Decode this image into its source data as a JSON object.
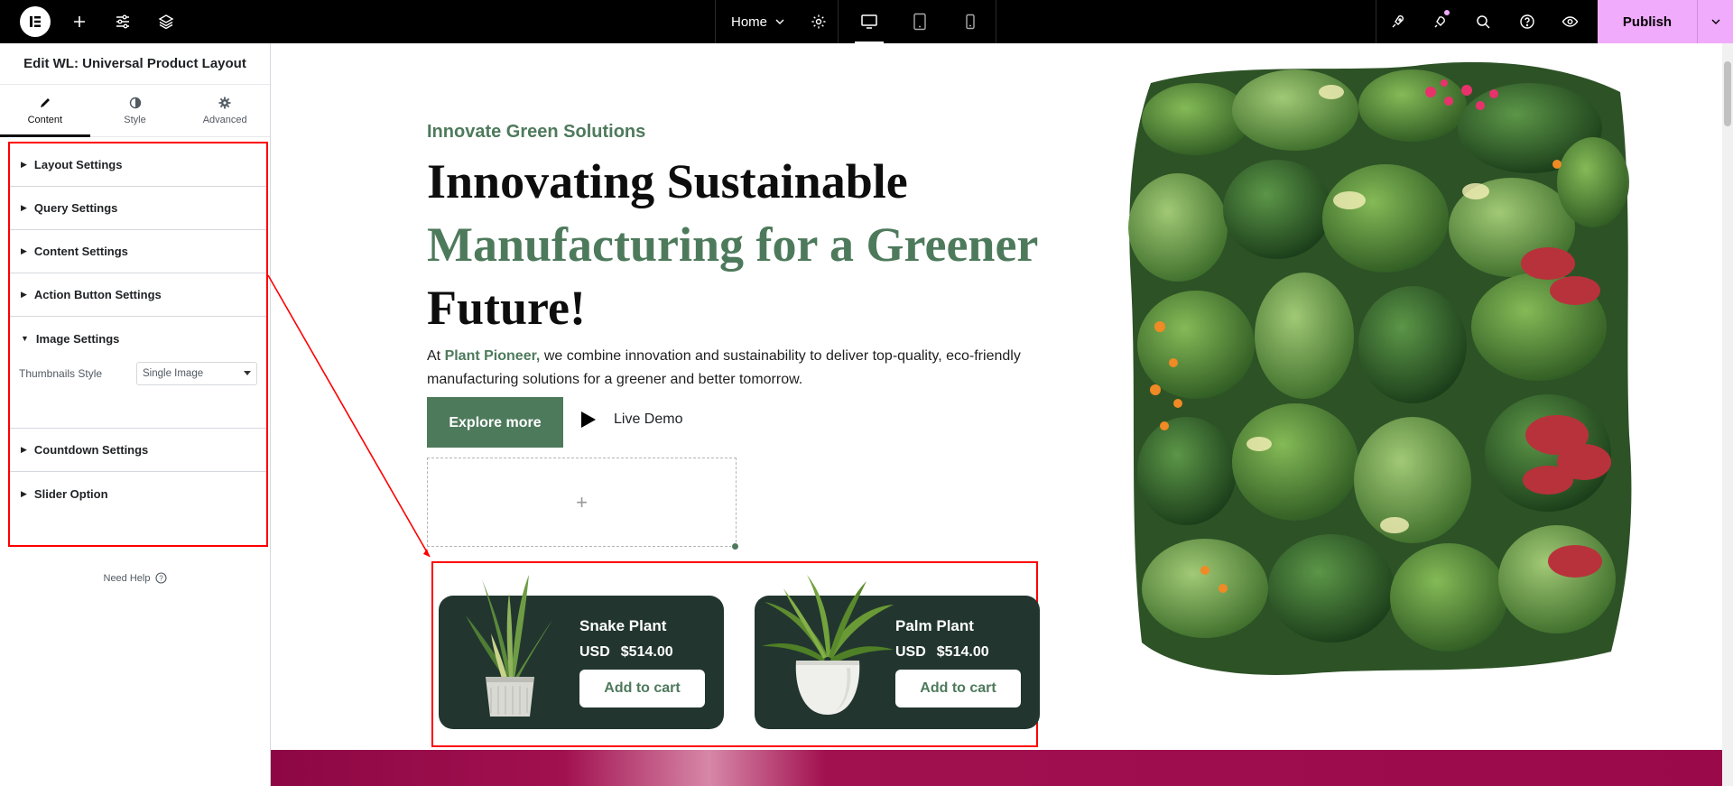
{
  "topbar": {
    "page_name": "Home",
    "publish_label": "Publish",
    "icons": [
      "elementor-logo-icon",
      "add-icon",
      "settings-sliders-icon",
      "layers-icon",
      "page-settings-icon",
      "desktop-icon",
      "tablet-icon",
      "mobile-icon",
      "launch-icon",
      "notifications-icon",
      "search-icon",
      "help-icon",
      "preview-icon"
    ]
  },
  "panel": {
    "title": "Edit WL: Universal Product Layout",
    "tabs": [
      {
        "label": "Content",
        "active": true
      },
      {
        "label": "Style",
        "active": false
      },
      {
        "label": "Advanced",
        "active": false
      }
    ],
    "sections": {
      "layout": "Layout Settings",
      "query": "Query Settings",
      "content": "Content Settings",
      "action_button": "Action Button Settings",
      "image": "Image Settings",
      "countdown": "Countdown Settings",
      "slider": "Slider Option"
    },
    "thumbnails_style": {
      "label": "Thumbnails Style",
      "value": "Single Image"
    },
    "need_help": "Need Help"
  },
  "hero": {
    "eyebrow": "Innovate Green Solutions",
    "headline_line1": "Innovating Sustainable",
    "headline_green": "Manufacturing for a Greener",
    "headline_line3": "Future!",
    "lead_prefix": "At ",
    "lead_brand": "Plant Pioneer,",
    "lead_suffix": " we combine innovation and sustainability to deliver top-quality, eco-friendly manufacturing solutions for a greener and better tomorrow.",
    "explore_label": "Explore more",
    "live_demo_label": "Live Demo",
    "add_widget": "+"
  },
  "products": [
    {
      "name": "Snake Plant",
      "currency": "USD",
      "price": "$514.00",
      "cta": "Add to cart"
    },
    {
      "name": "Palm Plant",
      "currency": "USD",
      "price": "$514.00",
      "cta": "Add to cart"
    }
  ],
  "colors": {
    "brand_green": "#4e7a5c",
    "card_dark": "#22362f",
    "publish_pink": "#f0abfc",
    "highlight_red": "#ff0000",
    "next_section": "#9a0a4b"
  }
}
